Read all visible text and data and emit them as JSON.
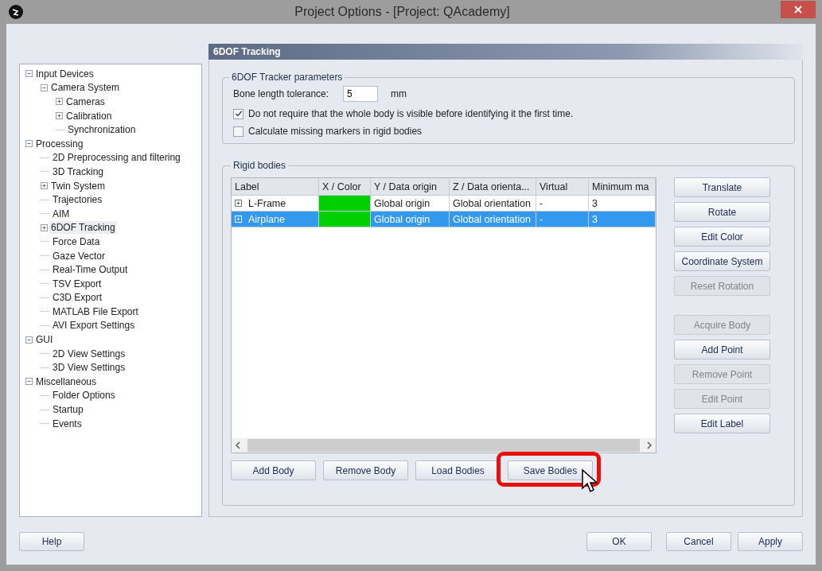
{
  "window": {
    "title": "Project Options - [Project: QAcademy]"
  },
  "tree": [
    {
      "label": "Input Devices",
      "expanded": true,
      "selected": false,
      "children": [
        {
          "label": "Camera System",
          "expanded": true,
          "selected": false,
          "children": [
            {
              "label": "Cameras",
              "expanded": false,
              "selected": false
            },
            {
              "label": "Calibration",
              "expanded": false,
              "selected": false
            },
            {
              "label": "Synchronization",
              "selected": false
            }
          ]
        }
      ]
    },
    {
      "label": "Processing",
      "expanded": true,
      "selected": false,
      "children": [
        {
          "label": "2D Preprocessing and filtering",
          "selected": false
        },
        {
          "label": "3D Tracking",
          "selected": false
        },
        {
          "label": "Twin System",
          "expanded": false,
          "selected": false
        },
        {
          "label": "Trajectories",
          "selected": false
        },
        {
          "label": "AIM",
          "selected": false
        },
        {
          "label": "6DOF Tracking",
          "expanded": false,
          "selected": true
        },
        {
          "label": "Force Data",
          "selected": false
        },
        {
          "label": "Gaze Vector",
          "selected": false
        },
        {
          "label": "Real-Time Output",
          "selected": false
        },
        {
          "label": "TSV Export",
          "selected": false
        },
        {
          "label": "C3D Export",
          "selected": false
        },
        {
          "label": "MATLAB File Export",
          "selected": false
        },
        {
          "label": "AVI Export Settings",
          "selected": false
        }
      ]
    },
    {
      "label": "GUI",
      "expanded": true,
      "selected": false,
      "children": [
        {
          "label": "2D View Settings",
          "selected": false
        },
        {
          "label": "3D View Settings",
          "selected": false
        }
      ]
    },
    {
      "label": "Miscellaneous",
      "expanded": true,
      "selected": false,
      "children": [
        {
          "label": "Folder Options",
          "selected": false
        },
        {
          "label": "Startup",
          "selected": false
        },
        {
          "label": "Events",
          "selected": false
        }
      ]
    }
  ],
  "page_title": "6DOF Tracking",
  "tracker_parameters": {
    "title": "6DOF Tracker parameters",
    "bone_length": {
      "label": "Bone length tolerance:",
      "value": "5",
      "unit": "mm"
    },
    "options": [
      {
        "label": "Do not require that the whole body is visible before identifying it the first time.",
        "checked": true
      },
      {
        "label": "Calculate missing markers in rigid bodies",
        "checked": false
      }
    ]
  },
  "rigid_bodies": {
    "title": "Rigid bodies",
    "table": {
      "columns": [
        "Label",
        "X / Color",
        "Y / Data origin",
        "Z / Data orienta...",
        "Virtual",
        "Minimum ma"
      ],
      "rows": [
        {
          "label": "L-Frame",
          "expanded": false,
          "color": "#00d000",
          "y": "Global origin",
          "z": "Global orientation",
          "virtual": "-",
          "minimum": "3",
          "selected": false
        },
        {
          "label": "Airplane",
          "expanded": false,
          "color": "#00d000",
          "y": "Global origin",
          "z": "Global orientation",
          "virtual": "-",
          "minimum": "3",
          "selected": true
        }
      ]
    },
    "side_buttons": [
      {
        "label": "Translate",
        "disabled": false
      },
      {
        "label": "Rotate",
        "disabled": false
      },
      {
        "label": "Edit Color",
        "disabled": false
      },
      {
        "label": "Coordinate System",
        "disabled": false
      },
      {
        "label": "Reset Rotation",
        "disabled": true
      },
      {
        "label": "Acquire Body",
        "disabled": true
      },
      {
        "label": "Add Point",
        "disabled": false
      },
      {
        "label": "Remove Point",
        "disabled": true
      },
      {
        "label": "Edit Point",
        "disabled": true
      },
      {
        "label": "Edit Label",
        "disabled": false
      }
    ],
    "bottom_buttons": [
      {
        "label": "Add Body",
        "highlighted": false
      },
      {
        "label": "Remove Body",
        "highlighted": false
      },
      {
        "label": "Load Bodies",
        "highlighted": false
      },
      {
        "label": "Save Bodies",
        "highlighted": true
      }
    ]
  },
  "footer": {
    "help": "Help",
    "buttons": [
      "OK",
      "Cancel",
      "Apply"
    ]
  }
}
